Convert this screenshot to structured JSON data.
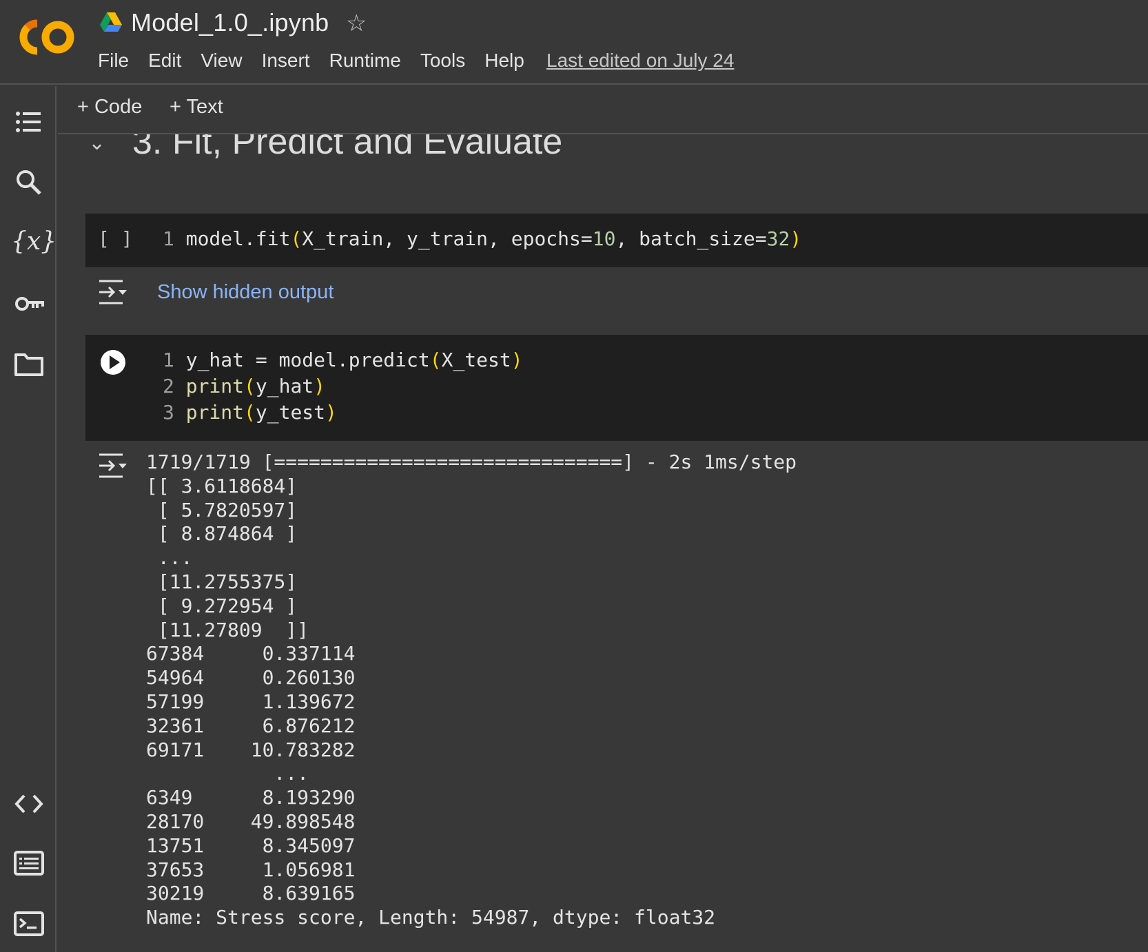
{
  "app": {
    "title": "Model_1.0_.ipynb",
    "last_edited": "Last edited on July 24",
    "logo_text": "CO",
    "accent_color": "#f9ab00"
  },
  "menu": [
    "File",
    "Edit",
    "View",
    "Insert",
    "Runtime",
    "Tools",
    "Help"
  ],
  "toolbar": {
    "code_label": "+ Code",
    "text_label": "+ Text"
  },
  "section": {
    "title": "3. Fit, Predict and Evaluate"
  },
  "cell1": {
    "exec_count": "[ ]",
    "line_number": "1",
    "code": "model.fit(X_train, y_train, epochs=10, batch_size=32)",
    "hidden_output_label": "Show hidden output"
  },
  "cell2": {
    "line_numbers": [
      "1",
      "2",
      "3"
    ],
    "lines": [
      "y_hat = model.predict(X_test)",
      "print(y_hat)",
      "print(y_test)"
    ]
  },
  "output": {
    "lines": [
      "1719/1719 [==============================] - 2s 1ms/step",
      "[[ 3.6118684]",
      " [ 5.7820597]",
      " [ 8.874864 ]",
      " ...",
      " [11.2755375]",
      " [ 9.272954 ]",
      " [11.27809  ]]",
      "67384     0.337114",
      "54964     0.260130",
      "57199     1.139672",
      "32361     6.876212",
      "69171    10.783282",
      "           ...   ",
      "6349      8.193290",
      "28170    49.898548",
      "13751     8.345097",
      "37653     1.056981",
      "30219     8.639165",
      "Name: Stress score, Length: 54987, dtype: float32"
    ]
  },
  "sidebar_icons": [
    "table-of-contents-icon",
    "search-icon",
    "variables-icon",
    "secrets-key-icon",
    "folder-icon",
    "code-snippets-icon",
    "command-palette-icon",
    "terminal-icon"
  ],
  "sidebar_variables_glyph": "{x}",
  "star_glyph": "☆"
}
